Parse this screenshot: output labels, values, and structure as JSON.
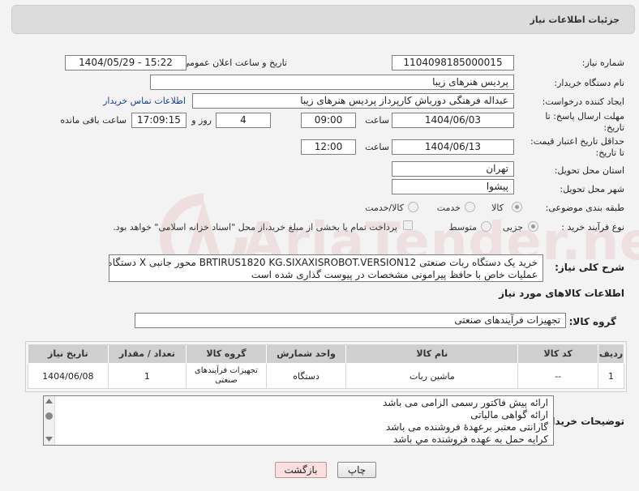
{
  "panel": {
    "title": "جزئیات اطلاعات نیاز"
  },
  "watermark": {
    "text": "AriaTender.neT",
    "color": "#c83c3c"
  },
  "form": {
    "need_number": {
      "label": "شماره نیاز:",
      "value": "1104098185000015"
    },
    "announce": {
      "label": "تاریخ و ساعت اعلان عمومی:",
      "value": "1404/05/29 - 15:22"
    },
    "buyer_org": {
      "label": "نام دستگاه خریدار:",
      "value": "پردیس هنرهای زیبا"
    },
    "creator": {
      "label": "ایجاد کننده درخواست:",
      "value": "عبداله فرهنگی دورباش کارپرداز پردیس هنرهای زیبا",
      "contact_link": "اطلاعات تماس خریدار"
    },
    "reply_deadline": {
      "label_line1": "مهلت ارسال پاسخ: تا",
      "label_line2": "تاریخ:",
      "date": "1404/06/03",
      "time_label": "ساعت",
      "time": "09:00",
      "days": "4",
      "days_label": "روز و",
      "remaining_time": "17:09:15",
      "remaining_label": "ساعت باقی مانده"
    },
    "price_validity": {
      "label_line1": "حداقل تاریخ اعتبار قیمت:",
      "label_line2": "تا تاریخ:",
      "date": "1404/06/13",
      "time_label": "ساعت",
      "time": "12:00"
    },
    "province": {
      "label": "استان محل تحویل:",
      "value": "تهران"
    },
    "city": {
      "label": "شهر محل تحویل:",
      "value": "پیشوا"
    },
    "category": {
      "label": "طبقه بندی موضوعی:",
      "options": [
        "کالا",
        "خدمت",
        "کالا/خدمت"
      ],
      "selected": "کالا"
    },
    "process": {
      "label": "نوع فرآیند خرید :",
      "options": [
        "جزیی",
        "متوسط"
      ],
      "selected": "جزیی",
      "payment_note": "پرداخت تمام یا بخشی از مبلغ خرید،از محل \"اسناد خزانه اسلامی\" خواهد بود."
    }
  },
  "general_desc": {
    "label": "شرح کلی نیاز:",
    "lines": [
      "خرید یک دستگاه ربات صنعتی BRTIRUS1820 KG.SIXAXISROBOT.VERSION12 محور جانبی X  دستگاه",
      "عملیات خاص با حافظ پیرامونی مشخصات در پیوست گذاری شده است"
    ]
  },
  "goods_section": {
    "title": "اطلاعات کالاهای مورد نیاز",
    "group_label": "گروه کالا:",
    "group_value": "تجهیزات فرآیندهای صنعتی"
  },
  "table": {
    "headers": [
      "ردیف",
      "کد کالا",
      "نام کالا",
      "واحد شمارش",
      "گروه کالا",
      "تعداد / مقدار",
      "تاریخ نیاز"
    ],
    "rows": [
      [
        "1",
        "--",
        "ماشین ربات",
        "دستگاه",
        "تجهیزات فرآیندهای صنعتی",
        "1",
        "1404/06/08"
      ]
    ]
  },
  "buyer_notes": {
    "label": "توضیحات خریدار:",
    "lines": [
      "ارائه پیش فاکتور رسمی الزامی می باشد",
      "ارائه گواهی مالیاتی",
      "گارانتی معتبر برعهدهٔ فروشنده می باشد",
      "کرایه حمل به عهده فروشنده مي باشد"
    ]
  },
  "buttons": {
    "print": "چاپ",
    "back": "بازگشت"
  }
}
